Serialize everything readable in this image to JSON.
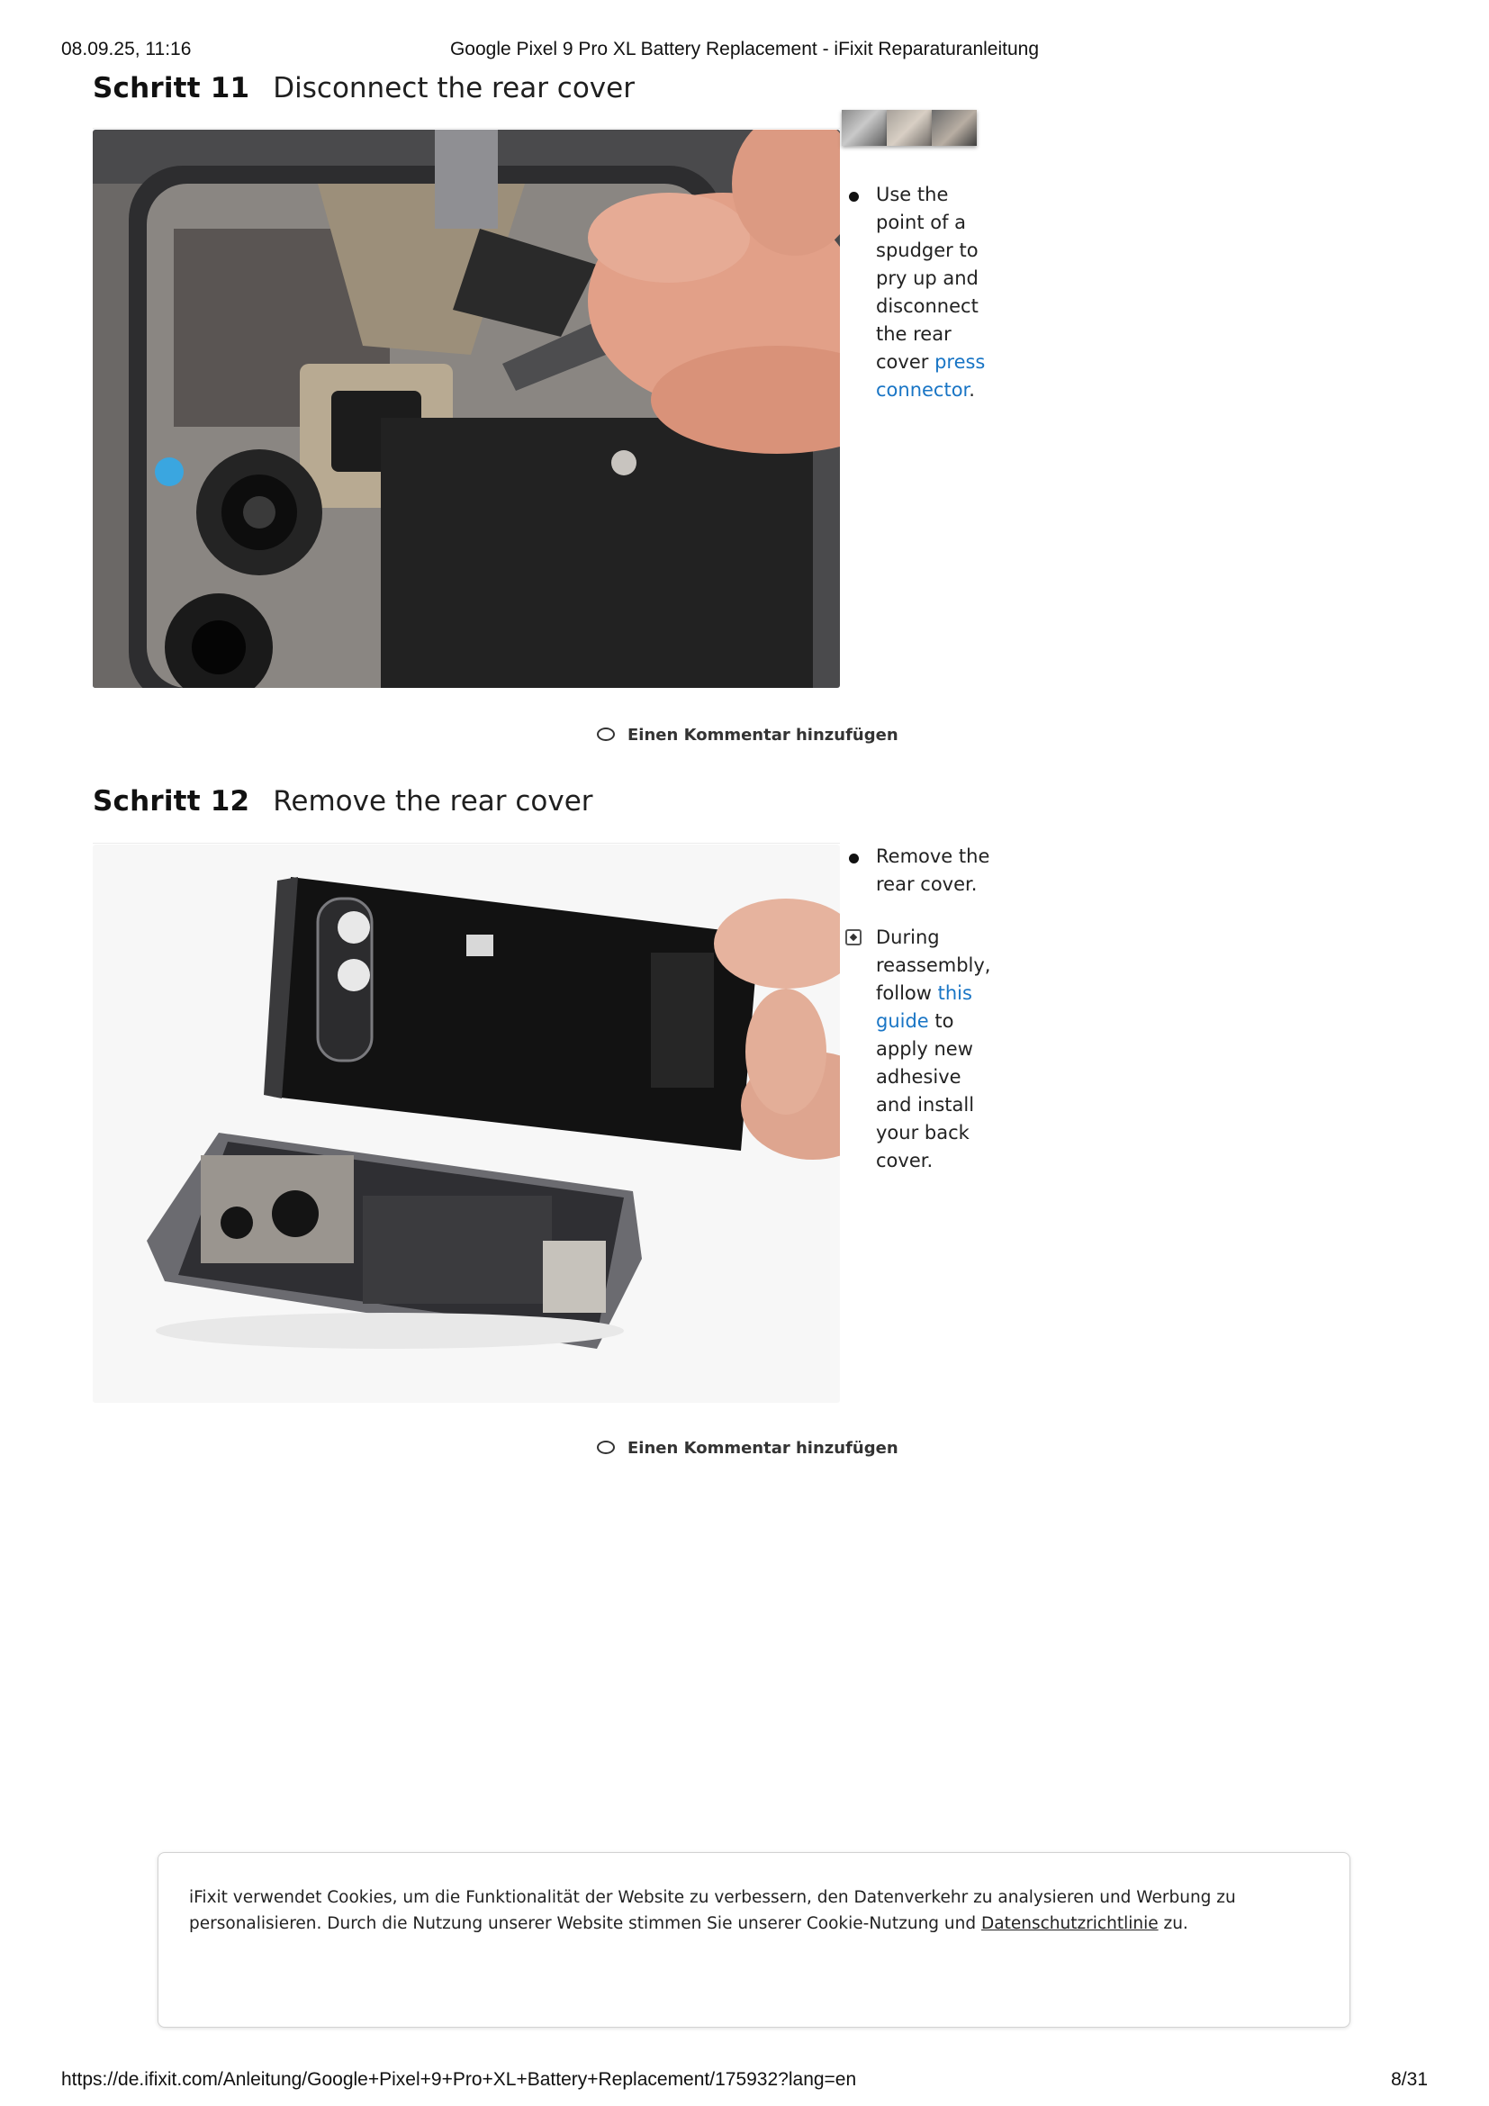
{
  "print_header": {
    "date": "08.09.25, 11:16",
    "title": "Google Pixel 9 Pro XL Battery Replacement - iFixit Reparaturanleitung"
  },
  "steps": [
    {
      "label": "Schritt 11",
      "title": "Disconnect the rear cover",
      "bullet_1": {
        "before": "Use the point of a spudger to pry up and disconnect the rear cover ",
        "link": "press connector",
        "after": "."
      },
      "comment": "Einen Kommentar hinzufügen"
    },
    {
      "label": "Schritt 12",
      "title": "Remove the rear cover",
      "bullet_1": "Remove the rear cover.",
      "note": {
        "before": "During reassembly, follow ",
        "link": "this guide",
        "after": " to apply new adhesive and install your back cover."
      },
      "comment": "Einen Kommentar hinzufügen"
    }
  ],
  "cookie_banner": {
    "text": "iFixit verwendet Cookies, um die Funktionalität der Website zu verbessern, den Datenverkehr zu analysieren und Werbung zu personalisieren. Durch die Nutzung unserer Website stimmen Sie unserer Cookie-Nutzung und ",
    "link": "Datenschutzrichtlinie",
    "after": " zu."
  },
  "print_footer": {
    "url": "https://de.ifixit.com/Anleitung/Google+Pixel+9+Pro+XL+Battery+Replacement/175932?lang=en",
    "page": "8/31"
  },
  "colors": {
    "link": "#1975c5",
    "heading": "#111111"
  },
  "icons": [
    "speech-bubble-icon",
    "note-icon",
    "bullet-dot-icon"
  ]
}
